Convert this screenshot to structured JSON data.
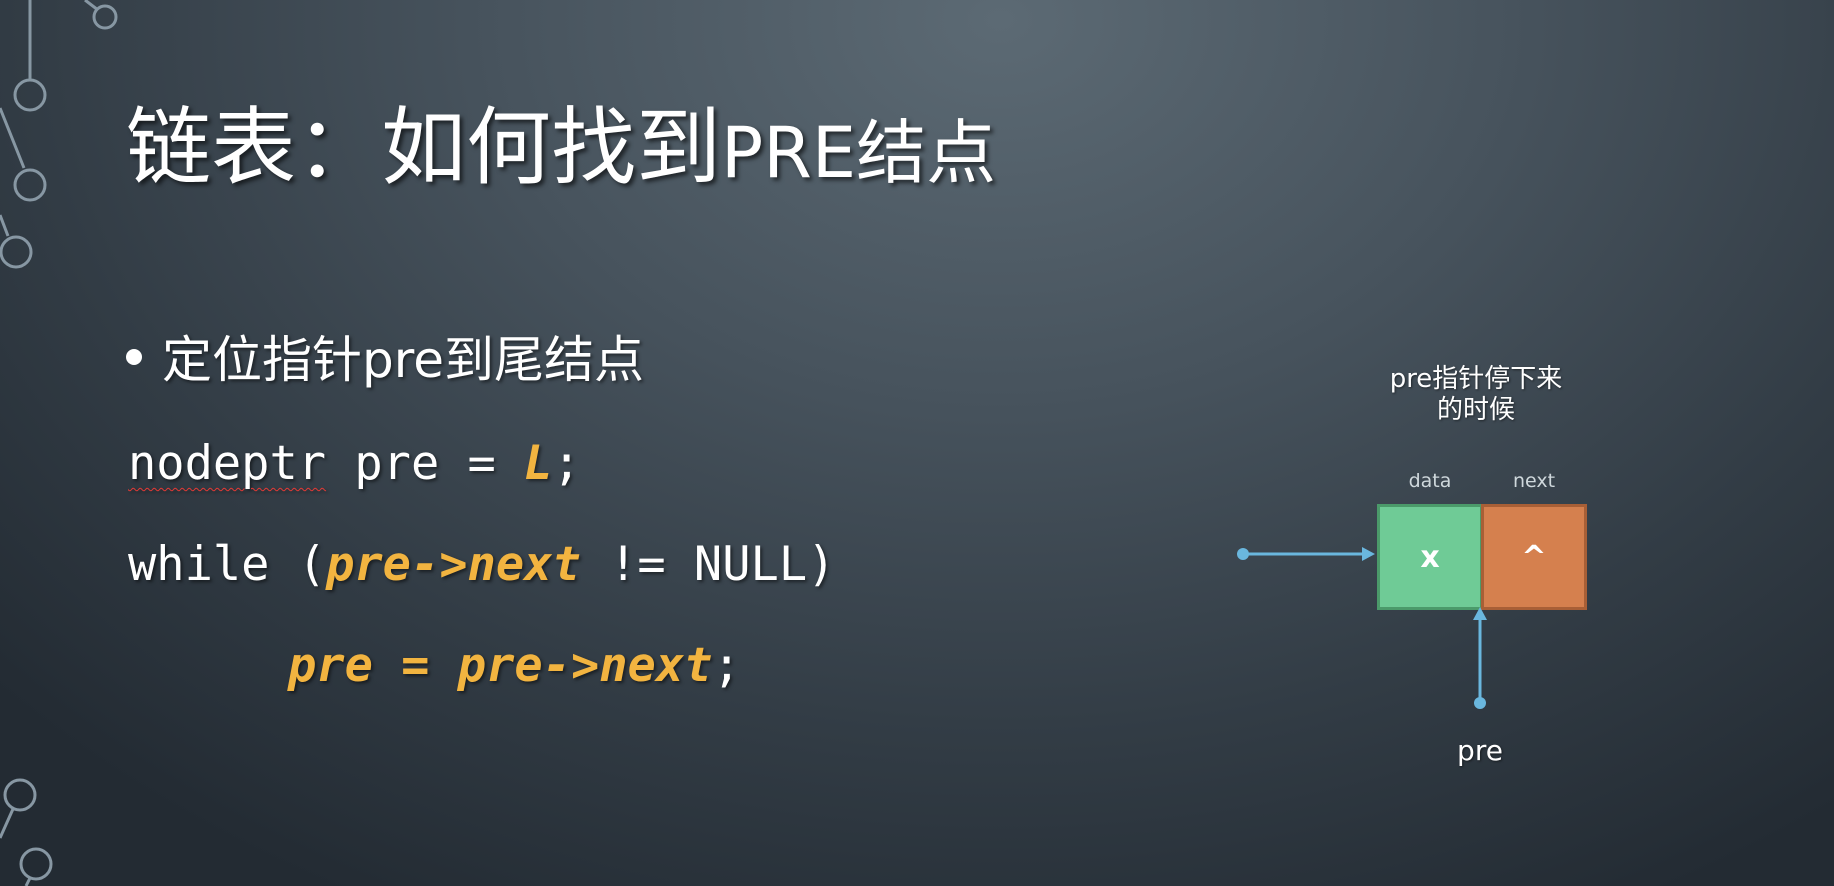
{
  "slide": {
    "title_main": "链表：如何找到",
    "title_suffix": "PRE结点",
    "bullet": "定位指针pre到尾结点"
  },
  "code": {
    "line1": {
      "type_name": "nodeptr",
      "before": " pre = ",
      "highlight": "L",
      "after": ";"
    },
    "line2": {
      "before": "while (",
      "highlight": "pre->next",
      "after": " != NULL)"
    },
    "line3": {
      "highlight": "pre = pre->next",
      "after": ";"
    },
    "highlight_color": "#f2b440"
  },
  "diagram": {
    "caption_line1": "pre指针停下来",
    "caption_line2": "的时候",
    "data_label": "data",
    "next_label": "next",
    "data_value": "x",
    "next_value": "^",
    "pointer_label": "pre",
    "data_color": "#6fcb96",
    "next_color": "#d5804e",
    "arrow_color": "#6ab7de"
  }
}
